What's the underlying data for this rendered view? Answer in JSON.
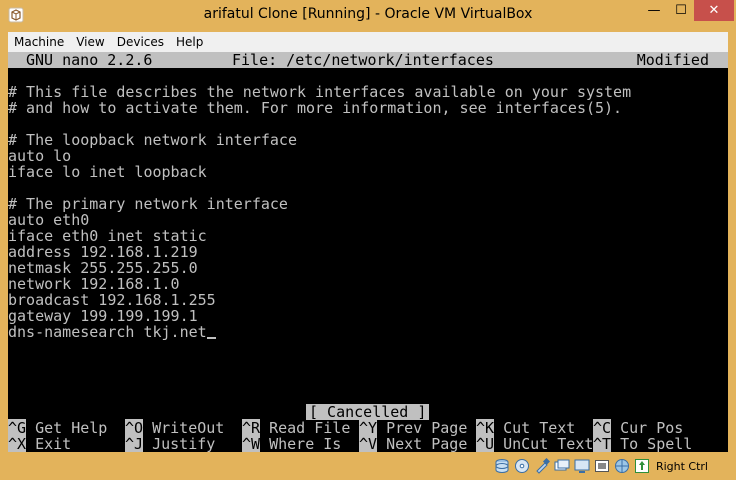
{
  "window": {
    "title": "arifatul Clone [Running] - Oracle VM VirtualBox",
    "minimize_glyph": "—",
    "maximize_glyph": "☐",
    "close_glyph": "✕"
  },
  "menu": {
    "items": [
      "Machine",
      "View",
      "Devices",
      "Help"
    ]
  },
  "nano": {
    "version": "GNU nano 2.2.6",
    "file": "File: /etc/network/interfaces",
    "modified": "Modified",
    "lines": [
      "# This file describes the network interfaces available on your system",
      "# and how to activate them. For more information, see interfaces(5).",
      "",
      "# The loopback network interface",
      "auto lo",
      "iface lo inet loopback",
      "",
      "# The primary network interface",
      "auto eth0",
      "iface eth0 inet static",
      "address 192.168.1.219",
      "netmask 255.255.255.0",
      "network 192.168.1.0",
      "broadcast 192.168.1.255",
      "gateway 199.199.199.1",
      "dns-namesearch tkj.net"
    ],
    "status_message": "[ Cancelled ]",
    "shortcuts_row1": [
      {
        "key": "^G",
        "label": " Get Help"
      },
      {
        "key": "^O",
        "label": " WriteOut"
      },
      {
        "key": "^R",
        "label": " Read File"
      },
      {
        "key": "^Y",
        "label": " Prev Page"
      },
      {
        "key": "^K",
        "label": " Cut Text"
      },
      {
        "key": "^C",
        "label": " Cur Pos"
      }
    ],
    "shortcuts_row2": [
      {
        "key": "^X",
        "label": " Exit"
      },
      {
        "key": "^J",
        "label": " Justify"
      },
      {
        "key": "^W",
        "label": " Where Is"
      },
      {
        "key": "^V",
        "label": " Next Page"
      },
      {
        "key": "^U",
        "label": " UnCut Text"
      },
      {
        "key": "^T",
        "label": " To Spell"
      }
    ]
  },
  "statusbar": {
    "host_key": "Right Ctrl",
    "icons": [
      "hard-disk-icon",
      "optical-drive-icon",
      "usb-icon",
      "shared-folders-icon",
      "display-icon",
      "video-capture-icon",
      "network-icon",
      "mouse-integration-icon"
    ]
  },
  "colors": {
    "frame": "#e3b35b",
    "terminal_bg": "#000000",
    "terminal_fg": "#c0c0c0",
    "close_button": "#c7504b"
  }
}
